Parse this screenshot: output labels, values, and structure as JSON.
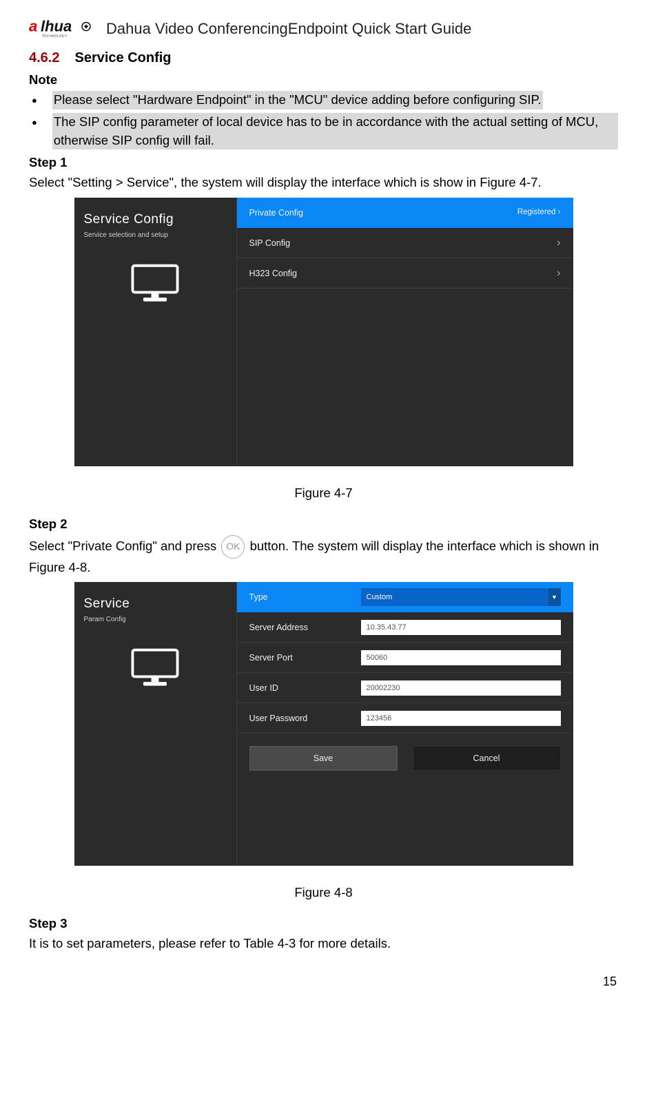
{
  "header": {
    "doc_title": "Dahua Video ConferencingEndpoint Quick Start Guide",
    "logo_brand_main": "a",
    "logo_brand_l": "lhua",
    "logo_tagline": "TECHNOLOGY"
  },
  "section": {
    "number": "4.6.2",
    "title": "Service Config"
  },
  "note_heading": "Note",
  "notes": [
    "Please select \"Hardware Endpoint\" in the \"MCU\" device adding before configuring SIP.",
    "The SIP config parameter of local device has to be in accordance with the actual setting of MCU, otherwise SIP config will fail."
  ],
  "step1": {
    "heading": "Step 1",
    "text": "Select \"Setting > Service\", the system will display the interface which is show in Figure 4-7."
  },
  "fig47": {
    "caption": "Figure 4-7",
    "side_title": "Service Config",
    "side_sub": "Service selection and setup",
    "rows": {
      "private": {
        "label": "Private Config",
        "status": "Registered"
      },
      "sip": {
        "label": "SIP Config"
      },
      "h323": {
        "label": "H323 Config"
      }
    }
  },
  "step2": {
    "heading": "Step 2",
    "text_a": "Select \"Private Config\" and press ",
    "ok_label": "OK",
    "text_b": " button. The system will display the interface which is shown in Figure 4-8."
  },
  "fig48": {
    "caption": "Figure 4-8",
    "side_title": "Service",
    "side_sub": "Param Config",
    "fields": {
      "type": {
        "label": "Type",
        "value": "Custom"
      },
      "addr": {
        "label": "Server Address",
        "value": "10.35.43.77"
      },
      "port": {
        "label": "Server Port",
        "value": "50060"
      },
      "uid": {
        "label": "User ID",
        "value": "20002230"
      },
      "pwd": {
        "label": "User Password",
        "value": "123456"
      }
    },
    "buttons": {
      "save": "Save",
      "cancel": "Cancel"
    }
  },
  "step3": {
    "heading": "Step 3",
    "text": "It is to set parameters, please refer to Table 4-3 for more details."
  },
  "page_number": "15"
}
